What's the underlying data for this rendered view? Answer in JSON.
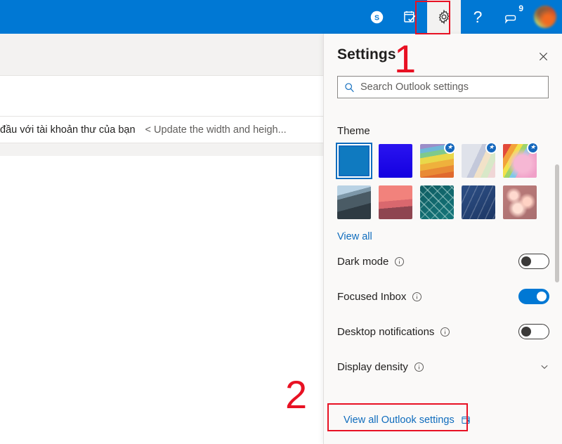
{
  "suitebar": {
    "background_color": "#0078d4",
    "items": [
      {
        "name": "skype-icon",
        "label": "Skype"
      },
      {
        "name": "tasks-icon",
        "label": "To Do"
      },
      {
        "name": "settings-gear-icon",
        "label": "Settings"
      },
      {
        "name": "help-icon",
        "label": "Help"
      },
      {
        "name": "feedback-icon",
        "label": "Feedback"
      }
    ],
    "help_glyph": "?",
    "notification_badge": "9",
    "avatar_label": "Account manager"
  },
  "background": {
    "row_text_left": "đầu với tài khoản thư của bạn",
    "row_text_right": "< Update the width and heigh..."
  },
  "panel": {
    "title": "Settings",
    "close_label": "×",
    "search": {
      "placeholder": "Search Outlook settings",
      "value": ""
    },
    "theme": {
      "section_title": "Theme",
      "view_all_label": "View all",
      "selected_index": 0,
      "swatches": [
        {
          "name": "theme-blue-solid",
          "label": "Blue",
          "color": "#0f7ac0",
          "premium": false
        },
        {
          "name": "theme-bright-blue",
          "label": "Bright blue",
          "color": "#1a0ee8",
          "premium": false
        },
        {
          "name": "theme-rainbow-stripes",
          "label": "Rainbow stripes",
          "color": "#e8a33d",
          "premium": true
        },
        {
          "name": "theme-pastel-swirl",
          "label": "Pastel swirl",
          "color": "#cfd3e0",
          "premium": true
        },
        {
          "name": "theme-unicorn",
          "label": "Unicorn",
          "color": "#f0a7c8",
          "premium": true
        },
        {
          "name": "theme-mountain",
          "label": "Mountain",
          "color": "#3d4a57",
          "premium": false
        },
        {
          "name": "theme-palm-sunset",
          "label": "Palm sunset",
          "color": "#e4726f",
          "premium": false
        },
        {
          "name": "theme-circuit",
          "label": "Circuit board",
          "color": "#13656b",
          "premium": false
        },
        {
          "name": "theme-innovation",
          "label": "Innovation",
          "color": "#274b7d",
          "premium": false
        },
        {
          "name": "theme-bokeh-lights",
          "label": "Bokeh lights",
          "color": "#c07b7b",
          "premium": false
        }
      ]
    },
    "settings_rows": [
      {
        "name": "dark-mode",
        "label": "Dark mode",
        "type": "toggle",
        "state": "off",
        "has_info": true
      },
      {
        "name": "focused-inbox",
        "label": "Focused Inbox",
        "type": "toggle",
        "state": "on",
        "has_info": true
      },
      {
        "name": "desktop-notifications",
        "label": "Desktop notifications",
        "type": "toggle",
        "state": "off",
        "has_info": true
      },
      {
        "name": "display-density",
        "label": "Display density",
        "type": "expander",
        "state": "collapsed",
        "has_info": true
      }
    ],
    "footer": {
      "view_all_settings_label": "View all Outlook settings"
    }
  },
  "annotations": {
    "accent_color": "#e81123",
    "marker_one": "1",
    "marker_two": "2"
  }
}
